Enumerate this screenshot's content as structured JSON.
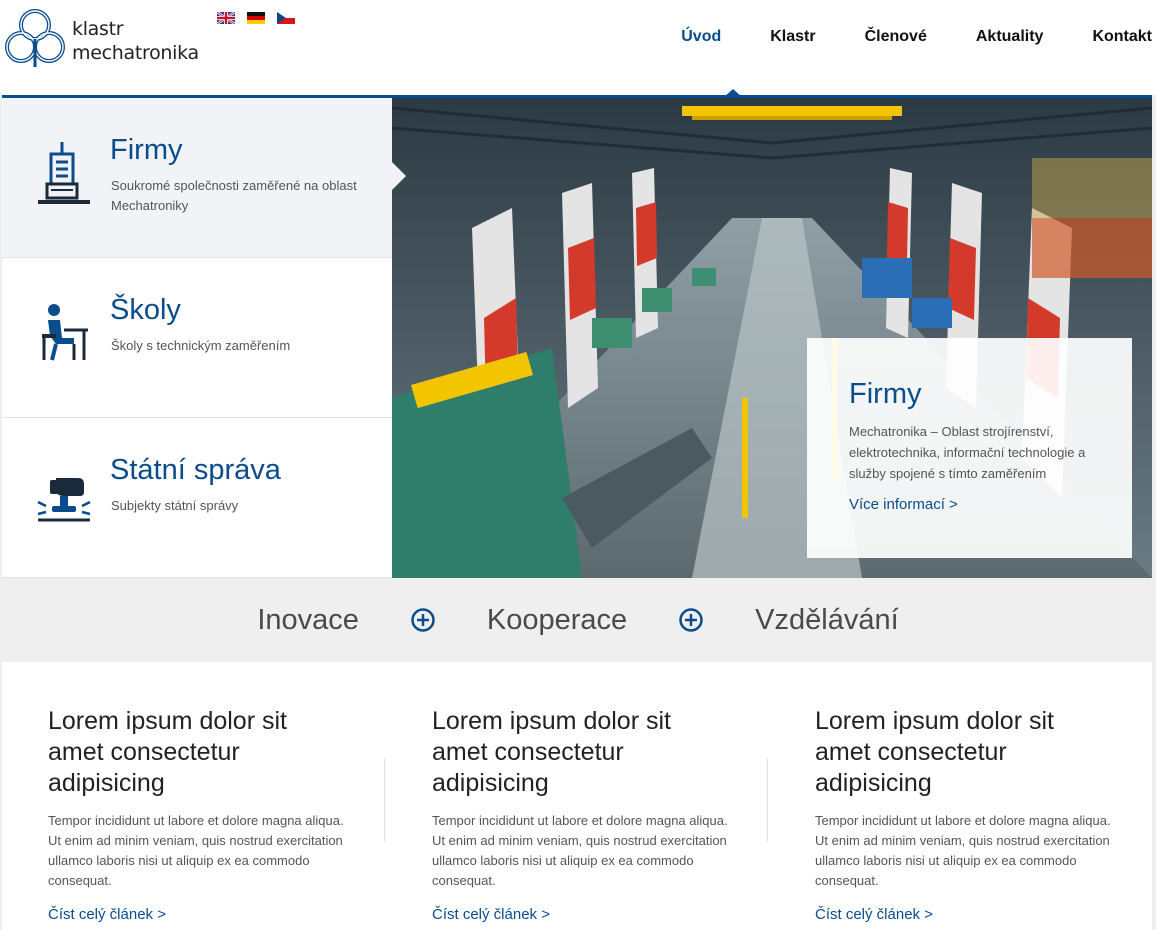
{
  "brand": {
    "line1": "klastr",
    "line2": "mechatronika",
    "accent": "#0a4c8c"
  },
  "languages": [
    {
      "icon": "uk-flag-icon"
    },
    {
      "icon": "de-flag-icon"
    },
    {
      "icon": "cz-flag-icon"
    }
  ],
  "nav": {
    "items": [
      {
        "label": "Úvod",
        "active": true
      },
      {
        "label": "Klastr"
      },
      {
        "label": "Členové"
      },
      {
        "label": "Aktuality"
      },
      {
        "label": "Kontakt"
      }
    ]
  },
  "categories": [
    {
      "title": "Firmy",
      "desc": "Soukromé společnosti zaměřené na oblast Mechatroniky",
      "icon": "building-icon",
      "active": true
    },
    {
      "title": "Školy",
      "desc": "Školy s technickým zaměřením",
      "icon": "student-desk-icon"
    },
    {
      "title": "Státní správa",
      "desc": "Subjekty státní správy",
      "icon": "gavel-stamp-icon"
    }
  ],
  "hero": {
    "title": "Firmy",
    "text": "Mechatronika – Oblast strojírenství, elektrotechnika, informační technologie a služby spojené s tímto zaměřením",
    "link": "Více informací >"
  },
  "pillars": {
    "items": [
      "Inovace",
      "Kooperace",
      "Vzdělávání"
    ],
    "separator_icon": "circle-plus-icon"
  },
  "articles": [
    {
      "title": "Lorem ipsum dolor sit amet consectetur adipisicing",
      "text": "Tempor incididunt ut labore et dolore magna aliqua. Ut enim ad minim veniam, quis nostrud exercitation ullamco laboris nisi ut aliquip ex ea commodo consequat.",
      "link": "Číst celý článek >"
    },
    {
      "title": "Lorem ipsum dolor sit amet consectetur adipisicing",
      "text": "Tempor incididunt ut labore et dolore magna aliqua. Ut enim ad minim veniam, quis nostrud exercitation ullamco laboris nisi ut aliquip ex ea commodo consequat.",
      "link": "Číst celý článek >"
    },
    {
      "title": "Lorem ipsum dolor sit amet consectetur adipisicing",
      "text": "Tempor incididunt ut labore et dolore magna aliqua. Ut enim ad minim veniam, quis nostrud exercitation ullamco laboris nisi ut aliquip ex ea commodo consequat.",
      "link": "Číst celý článek >"
    }
  ]
}
